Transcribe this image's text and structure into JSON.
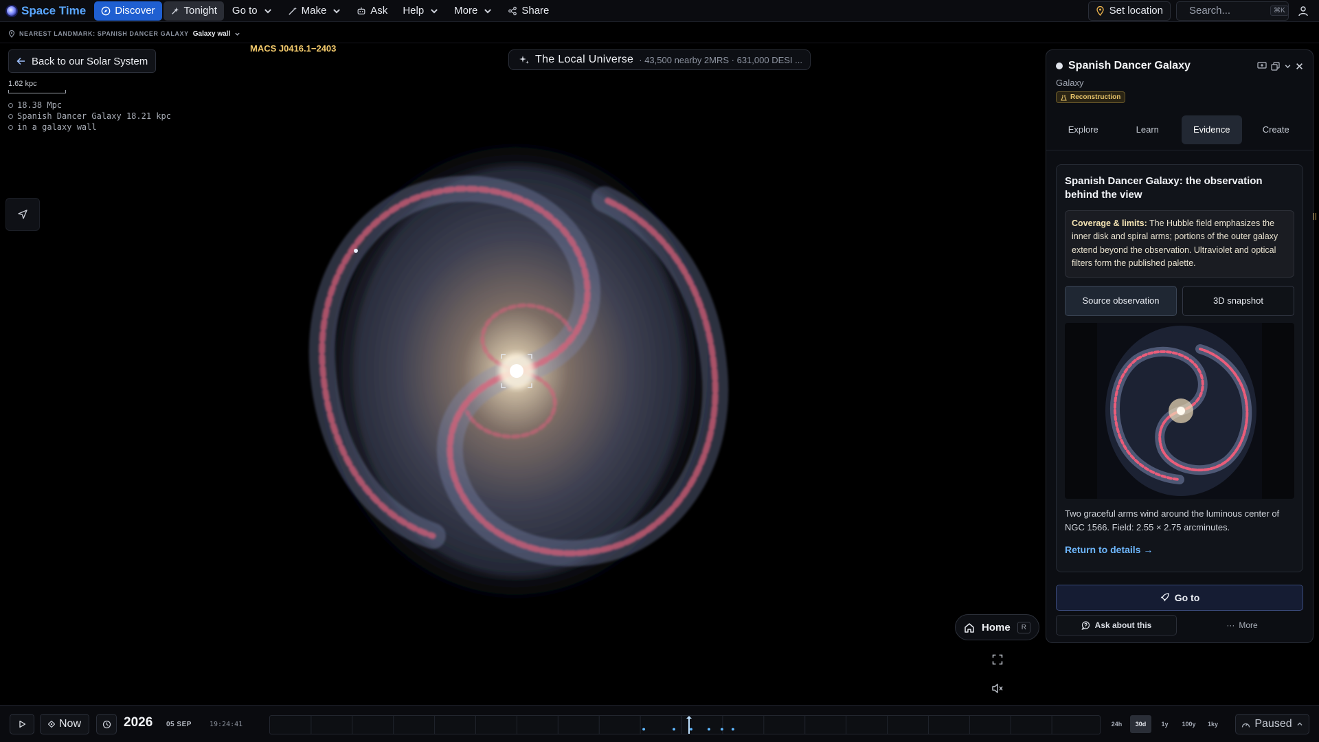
{
  "app": {
    "name": "Space Time"
  },
  "nav": {
    "discover": "Discover",
    "tonight": "Tonight",
    "goto": "Go to",
    "make": "Make",
    "ask": "Ask",
    "help": "Help",
    "more": "More",
    "share": "Share"
  },
  "topright": {
    "set_location": "Set location",
    "search_placeholder": "Search...",
    "search_shortcut": "⌘K"
  },
  "landmark": {
    "label": "NEAREST LANDMARK: SPANISH DANCER GALAXY",
    "wall": "Galaxy wall"
  },
  "left": {
    "back": "Back to our Solar System",
    "scale": "1.62 kpc",
    "readout": [
      "18.38 Mpc",
      "Spanish Dancer Galaxy 18.21 kpc",
      "in a galaxy wall"
    ]
  },
  "cluster_label": "MACS J0416.1−2403",
  "universe": {
    "title": "The Local Universe",
    "detail": "· 43,500 nearby 2MRS · 631,000 DESI ..."
  },
  "controls": {
    "home": "Home",
    "home_key": "R"
  },
  "panel": {
    "title": "Spanish Dancer Galaxy",
    "type": "Galaxy",
    "badge": "Reconstruction",
    "tabs": [
      "Explore",
      "Learn",
      "Evidence",
      "Create"
    ],
    "active_tab": "Evidence",
    "evidence": {
      "heading": "Spanish Dancer Galaxy: the observation behind the view",
      "limits_label": "Coverage & limits:",
      "limits_text": "The Hubble field emphasizes the inner disk and spiral arms; portions of the outer galaxy extend beyond the observation. Ultraviolet and optical filters form the published palette.",
      "btn_source": "Source observation",
      "btn_snapshot": "3D snapshot",
      "caption": "Two graceful arms wind around the luminous center of NGC 1566. Field: 2.55 × 2.75 arcminutes.",
      "return": "Return to details →"
    },
    "goto": "Go to",
    "ask": "Ask about this",
    "more": "More"
  },
  "timebar": {
    "now": "Now",
    "year": "2026",
    "date": "05 SEP",
    "time": "19:24:41",
    "scales": [
      "24h",
      "30d",
      "1y",
      "100y",
      "1ky"
    ],
    "active_scale": "30d",
    "status": "Paused"
  },
  "colors": {
    "accent": "#1f5fd1",
    "brand": "#5aa7ff",
    "badge": "#e8c46a",
    "link": "#6fb8ff",
    "cluster_label": "#f2c96b"
  }
}
